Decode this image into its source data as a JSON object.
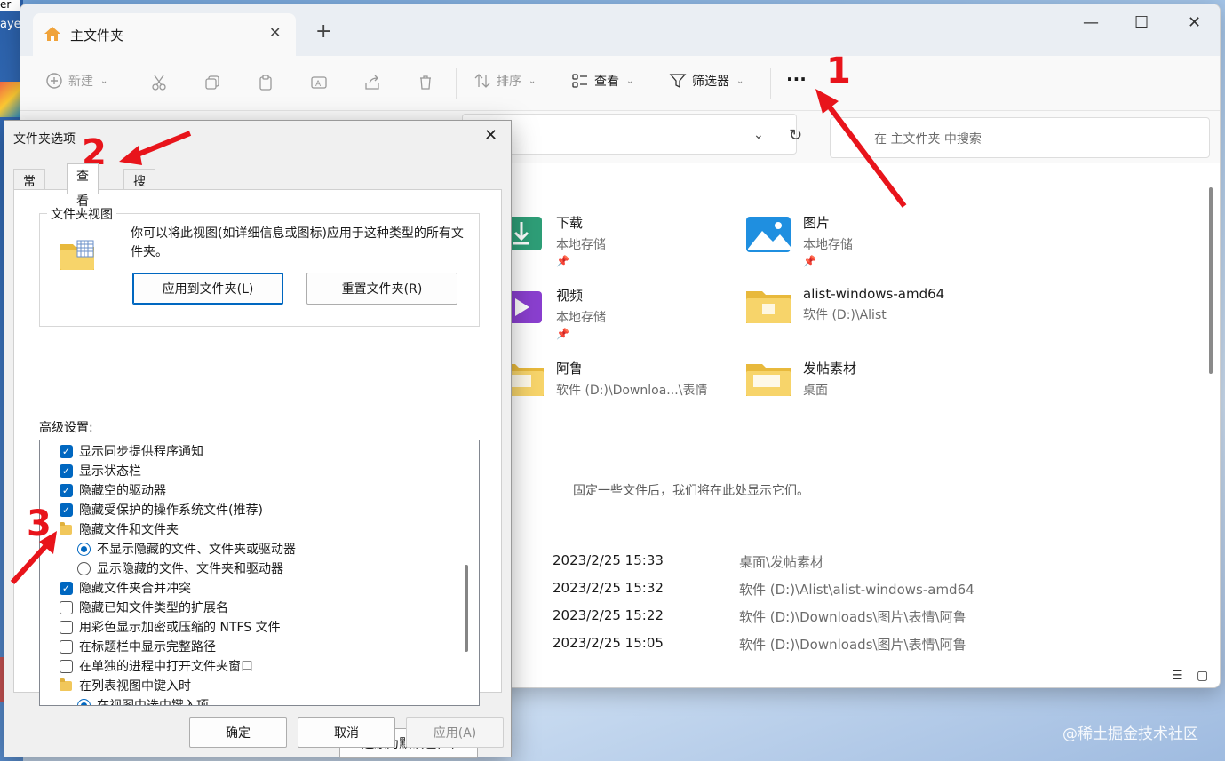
{
  "desktop": {
    "label_fragment": "aye",
    "label_fragment2": "er"
  },
  "explorer": {
    "tab_title": "主文件夹",
    "new_tab": "+",
    "window_controls": {
      "minimize": "—",
      "maximize": "☐",
      "close": "✕"
    },
    "toolbar": {
      "new_label": "新建",
      "sort_label": "排序",
      "view_label": "查看",
      "filter_label": "筛选器",
      "more_label": "···"
    },
    "search_placeholder": "在 主文件夹 中搜索",
    "quick_access": [
      {
        "name": "下载",
        "sub": "本地存储",
        "icon": "download-folder-icon",
        "pinned": true
      },
      {
        "name": "图片",
        "sub": "本地存储",
        "icon": "pictures-folder-icon",
        "pinned": true
      },
      {
        "name": "视频",
        "sub": "本地存储",
        "icon": "videos-folder-icon",
        "pinned": true
      },
      {
        "name": "alist-windows-amd64",
        "sub": "软件 (D:)\\Alist",
        "icon": "folder-icon",
        "pinned": false
      },
      {
        "name": "阿鲁",
        "sub": "软件 (D:)\\Downloa...\\表情",
        "icon": "folder-icon",
        "pinned": false
      },
      {
        "name": "发帖素材",
        "sub": "桌面",
        "icon": "folder-icon",
        "pinned": false
      }
    ],
    "empty_note": "固定一些文件后，我们将在此处显示它们。",
    "recent": [
      {
        "date": "2023/2/25 15:33",
        "location": "桌面\\发帖素材"
      },
      {
        "date": "2023/2/25 15:32",
        "location": "软件 (D:)\\Alist\\alist-windows-amd64"
      },
      {
        "date": "2023/2/25 15:22",
        "location": "软件 (D:)\\Downloads\\图片\\表情\\阿鲁"
      },
      {
        "date": "2023/2/25 15:05",
        "location": "软件 (D:)\\Downloads\\图片\\表情\\阿鲁"
      }
    ]
  },
  "dialog": {
    "title": "文件夹选项",
    "close": "✕",
    "tabs": [
      "常规",
      "查看",
      "搜索"
    ],
    "active_tab": "查看",
    "folder_views": {
      "label": "文件夹视图",
      "description": "你可以将此视图(如详细信息或图标)应用于这种类型的所有文件夹。",
      "apply_button": "应用到文件夹(L)",
      "reset_button": "重置文件夹(R)"
    },
    "advanced_label": "高级设置:",
    "settings": [
      {
        "type": "checkbox",
        "checked": true,
        "label": "显示同步提供程序通知",
        "indent": 1
      },
      {
        "type": "checkbox",
        "checked": true,
        "label": "显示状态栏",
        "indent": 1
      },
      {
        "type": "checkbox",
        "checked": true,
        "label": "隐藏空的驱动器",
        "indent": 1
      },
      {
        "type": "checkbox",
        "checked": true,
        "label": "隐藏受保护的操作系统文件(推荐)",
        "indent": 1
      },
      {
        "type": "folder",
        "label": "隐藏文件和文件夹",
        "indent": 1
      },
      {
        "type": "radio",
        "checked": true,
        "label": "不显示隐藏的文件、文件夹或驱动器",
        "indent": 2
      },
      {
        "type": "radio",
        "checked": false,
        "label": "显示隐藏的文件、文件夹和驱动器",
        "indent": 2
      },
      {
        "type": "checkbox",
        "checked": true,
        "label": "隐藏文件夹合并冲突",
        "indent": 1
      },
      {
        "type": "checkbox",
        "checked": false,
        "label": "隐藏已知文件类型的扩展名",
        "indent": 1
      },
      {
        "type": "checkbox",
        "checked": false,
        "label": "用彩色显示加密或压缩的 NTFS 文件",
        "indent": 1
      },
      {
        "type": "checkbox",
        "checked": false,
        "label": "在标题栏中显示完整路径",
        "indent": 1
      },
      {
        "type": "checkbox",
        "checked": false,
        "label": "在单独的进程中打开文件夹窗口",
        "indent": 1
      },
      {
        "type": "folder",
        "label": "在列表视图中键入时",
        "indent": 1
      },
      {
        "type": "radio",
        "checked": true,
        "label": "在视图中选中键入项",
        "indent": 2
      }
    ],
    "restore_defaults": "还原为默认值(D)",
    "ok": "确定",
    "cancel": "取消",
    "apply": "应用(A)"
  },
  "annotations": {
    "step1": "1",
    "step2": "2",
    "step3": "3",
    "color": "#e8141b"
  },
  "watermark": "@稀土掘金技术社区"
}
